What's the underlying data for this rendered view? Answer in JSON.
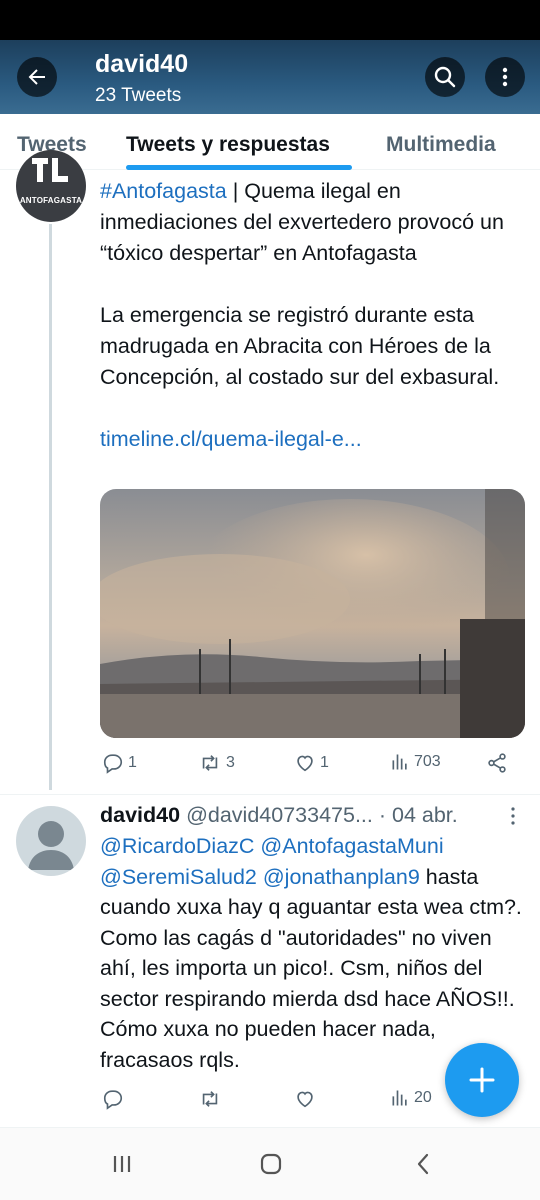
{
  "header": {
    "name": "david40",
    "tweet_count": "23 Tweets"
  },
  "tabs": [
    {
      "label": "Tweets"
    },
    {
      "label": "Tweets y respuestas"
    },
    {
      "label": "Multimedia"
    }
  ],
  "tweet1": {
    "avatar_text": "ANTOFAGASTA",
    "hashtag": "#Antofagasta",
    "text_line1_rest": " | Quema ilegal en inmediaciones del exvertedero provocó un “tóxico despertar” en Antofagasta",
    "paragraph2": "La emergencia se registró durante esta madrugada en Abracita con Héroes de la Concepción, al costado sur del exbasural.",
    "link": "timeline.cl/quema-ilegal-e...",
    "replies": "1",
    "retweets": "3",
    "likes": "1",
    "views": "703"
  },
  "tweet2": {
    "name": "david40",
    "handle": "@david40733475...",
    "date": "· 04 abr.",
    "mentions1": "@RicardoDiazC @AntofagastaMuni",
    "mention3": "@SeremiSalud2",
    "mention4": "@jonathanplan9",
    "text": " hasta cuando xuxa hay q aguantar esta wea ctm?. Como las cagás d \"autoridades\" no viven ahí, les importa un pico!. Csm, niños del sector respirando mierda dsd hace AÑOS!!. Cómo xuxa no pueden hacer nada, fracasaos rqls.",
    "replies": "",
    "retweets": "",
    "likes": "",
    "views": "20"
  },
  "colors": {
    "accent": "#1d9bf0",
    "link": "#1d6fbf",
    "muted": "#536471"
  },
  "icons": [
    "back-arrow-icon",
    "search-icon",
    "more-vertical-icon",
    "reply-icon",
    "retweet-icon",
    "like-icon",
    "views-icon",
    "share-icon",
    "compose-plus-icon",
    "recent-apps-icon",
    "home-icon",
    "nav-back-icon"
  ]
}
